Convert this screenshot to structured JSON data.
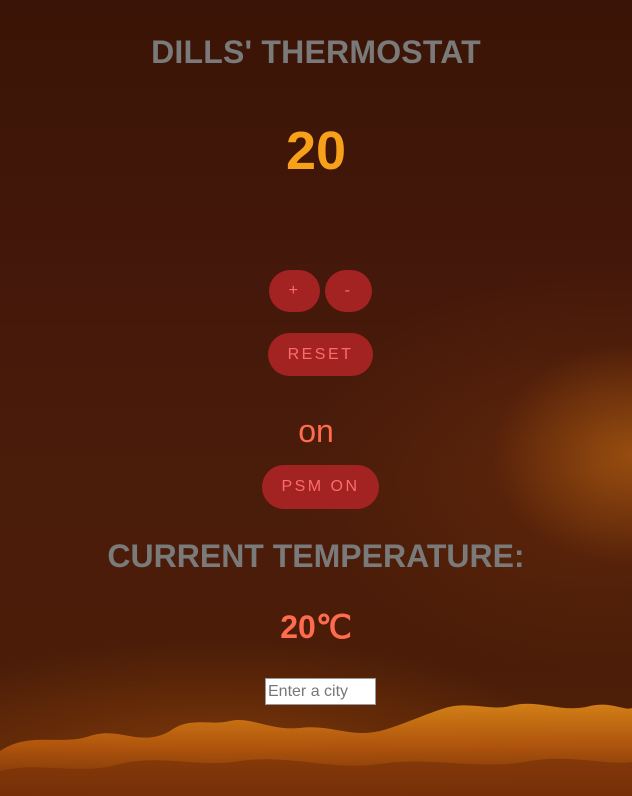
{
  "header": {
    "title": "DILLS' THERMOSTAT"
  },
  "thermostat": {
    "setpoint": "20",
    "increase_label": "+",
    "decrease_label": "-",
    "reset_label": "RESET",
    "power_saving_status": "on",
    "psm_button_label": "PSM ON"
  },
  "weather": {
    "current_label": "CURRENT TEMPERATURE:",
    "current_value": "20℃",
    "city_placeholder": "Enter a city"
  },
  "colors": {
    "setpoint": "#f7a11a",
    "button_bg": "#a32222",
    "button_text": "#ff6b6b",
    "status_text": "#ff6b4e",
    "heading_gray": "#7a7a7a"
  }
}
